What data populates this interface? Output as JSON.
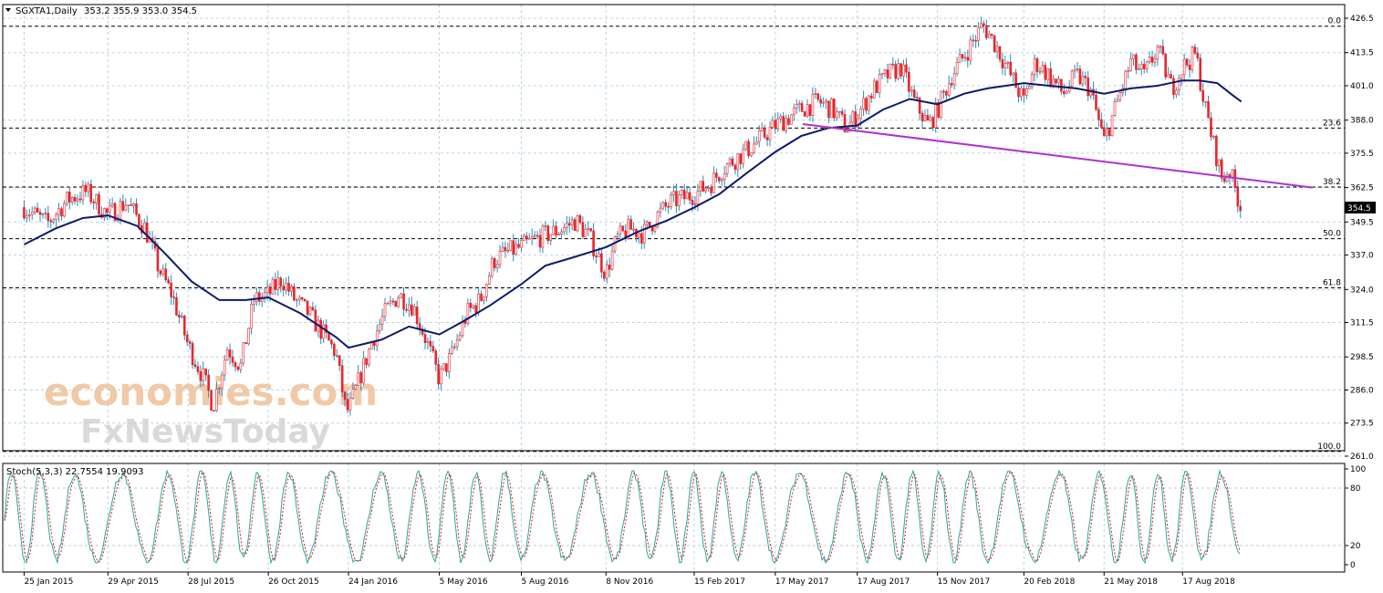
{
  "chart_data": {
    "type": "candlestick",
    "header": {
      "symbol": "SGXTA1,Daily",
      "ohlc": "353.2 355.9 353.0 354.5"
    },
    "last_price": "354.5",
    "x_ticks": [
      "25 Jan 2015",
      "29 Apr 2015",
      "28 Jul 2015",
      "26 Oct 2015",
      "24 Jan 2016",
      "5 May 2016",
      "5 Aug 2016",
      "8 Nov 2016",
      "15 Feb 2017",
      "17 May 2017",
      "17 Aug 2017",
      "15 Nov 2017",
      "20 Feb 2018",
      "21 May 2018",
      "17 Aug 2018"
    ],
    "y_ticks": [
      "426.5",
      "413.5",
      "401.0",
      "388.0",
      "375.5",
      "362.5",
      "349.5",
      "337.0",
      "324.0",
      "311.5",
      "298.5",
      "286.0",
      "273.5",
      "261.0"
    ],
    "ylim": [
      258,
      430
    ],
    "fib_levels": [
      {
        "label": "0.0",
        "price": 423.5
      },
      {
        "label": "23.6",
        "price": 385.0
      },
      {
        "label": "38.2",
        "price": 362.7
      },
      {
        "label": "50.0",
        "price": 343.2
      },
      {
        "label": "61.8",
        "price": 324.6
      },
      {
        "label": "100.0",
        "price": 262.8
      }
    ],
    "trendline": {
      "start": {
        "x": "17 Jun 2017",
        "y": 386.5
      },
      "end": {
        "x": "10 Jan 2019",
        "y": 362.5
      },
      "color": "#b030d0"
    },
    "price_close": [
      [
        "2015-01-25",
        355
      ],
      [
        "2015-02-20",
        349
      ],
      [
        "2015-03-15",
        358
      ],
      [
        "2015-04-05",
        361
      ],
      [
        "2015-04-29",
        352
      ],
      [
        "2015-05-20",
        357
      ],
      [
        "2015-06-10",
        347
      ],
      [
        "2015-06-25",
        332
      ],
      [
        "2015-07-10",
        322
      ],
      [
        "2015-07-28",
        303
      ],
      [
        "2015-08-15",
        290
      ],
      [
        "2015-08-25",
        280
      ],
      [
        "2015-09-10",
        302
      ],
      [
        "2015-09-25",
        295
      ],
      [
        "2015-10-10",
        320
      ],
      [
        "2015-10-26",
        322
      ],
      [
        "2015-11-10",
        328
      ],
      [
        "2015-11-25",
        320
      ],
      [
        "2015-12-10",
        315
      ],
      [
        "2015-12-25",
        308
      ],
      [
        "2016-01-10",
        300
      ],
      [
        "2016-01-20",
        280
      ],
      [
        "2016-01-24",
        278
      ],
      [
        "2016-02-05",
        290
      ],
      [
        "2016-02-20",
        305
      ],
      [
        "2016-03-05",
        315
      ],
      [
        "2016-03-20",
        322
      ],
      [
        "2016-04-05",
        318
      ],
      [
        "2016-04-20",
        305
      ],
      [
        "2016-05-05",
        290
      ],
      [
        "2016-05-20",
        300
      ],
      [
        "2016-06-05",
        315
      ],
      [
        "2016-06-20",
        320
      ],
      [
        "2016-07-05",
        335
      ],
      [
        "2016-07-20",
        338
      ],
      [
        "2016-08-05",
        340
      ],
      [
        "2016-08-20",
        343
      ],
      [
        "2016-09-05",
        345
      ],
      [
        "2016-09-20",
        347
      ],
      [
        "2016-10-05",
        350
      ],
      [
        "2016-10-20",
        344
      ],
      [
        "2016-11-08",
        330
      ],
      [
        "2016-11-20",
        343
      ],
      [
        "2016-12-05",
        347
      ],
      [
        "2016-12-20",
        345
      ],
      [
        "2017-01-05",
        352
      ],
      [
        "2017-01-20",
        357
      ],
      [
        "2017-02-15",
        360
      ],
      [
        "2017-03-05",
        364
      ],
      [
        "2017-03-20",
        370
      ],
      [
        "2017-04-05",
        374
      ],
      [
        "2017-04-20",
        378
      ],
      [
        "2017-05-17",
        386
      ],
      [
        "2017-06-05",
        390
      ],
      [
        "2017-06-20",
        393
      ],
      [
        "2017-07-05",
        395
      ],
      [
        "2017-07-20",
        392
      ],
      [
        "2017-08-05",
        385
      ],
      [
        "2017-08-17",
        390
      ],
      [
        "2017-09-05",
        400
      ],
      [
        "2017-09-20",
        405
      ],
      [
        "2017-10-05",
        408
      ],
      [
        "2017-10-20",
        395
      ],
      [
        "2017-11-05",
        386
      ],
      [
        "2017-11-15",
        392
      ],
      [
        "2017-12-01",
        405
      ],
      [
        "2017-12-20",
        415
      ],
      [
        "2018-01-05",
        424
      ],
      [
        "2018-01-20",
        416
      ],
      [
        "2018-02-05",
        405
      ],
      [
        "2018-02-20",
        395
      ],
      [
        "2018-03-05",
        410
      ],
      [
        "2018-03-20",
        405
      ],
      [
        "2018-04-05",
        398
      ],
      [
        "2018-04-20",
        405
      ],
      [
        "2018-05-05",
        400
      ],
      [
        "2018-05-21",
        380
      ],
      [
        "2018-06-05",
        395
      ],
      [
        "2018-06-20",
        410
      ],
      [
        "2018-07-05",
        405
      ],
      [
        "2018-07-20",
        415
      ],
      [
        "2018-08-05",
        400
      ],
      [
        "2018-08-17",
        408
      ],
      [
        "2018-09-01",
        413
      ],
      [
        "2018-09-10",
        395
      ],
      [
        "2018-09-20",
        380
      ],
      [
        "2018-10-01",
        365
      ],
      [
        "2018-10-08",
        370
      ],
      [
        "2018-10-15",
        362
      ],
      [
        "2018-10-22",
        354.5
      ]
    ],
    "ma": [
      [
        "2015-01-25",
        341
      ],
      [
        "2015-03-01",
        347
      ],
      [
        "2015-04-01",
        351
      ],
      [
        "2015-04-29",
        352
      ],
      [
        "2015-06-01",
        348
      ],
      [
        "2015-07-01",
        338
      ],
      [
        "2015-08-01",
        327
      ],
      [
        "2015-09-01",
        320
      ],
      [
        "2015-10-01",
        320
      ],
      [
        "2015-10-26",
        321
      ],
      [
        "2015-12-01",
        315
      ],
      [
        "2016-01-10",
        306
      ],
      [
        "2016-01-24",
        302
      ],
      [
        "2016-03-01",
        305
      ],
      [
        "2016-04-01",
        310
      ],
      [
        "2016-05-05",
        307
      ],
      [
        "2016-06-01",
        312
      ],
      [
        "2016-07-01",
        318
      ],
      [
        "2016-08-05",
        326
      ],
      [
        "2016-09-01",
        333
      ],
      [
        "2016-10-01",
        336
      ],
      [
        "2016-11-08",
        340
      ],
      [
        "2016-12-15",
        346
      ],
      [
        "2017-01-15",
        350
      ],
      [
        "2017-02-15",
        355
      ],
      [
        "2017-03-15",
        360
      ],
      [
        "2017-04-15",
        368
      ],
      [
        "2017-05-17",
        376
      ],
      [
        "2017-06-15",
        382
      ],
      [
        "2017-07-15",
        385
      ],
      [
        "2017-08-17",
        386
      ],
      [
        "2017-09-15",
        392
      ],
      [
        "2017-10-15",
        396
      ],
      [
        "2017-11-15",
        394
      ],
      [
        "2017-12-15",
        398
      ],
      [
        "2018-01-10",
        400
      ],
      [
        "2018-02-20",
        402
      ],
      [
        "2018-03-20",
        401
      ],
      [
        "2018-04-20",
        400
      ],
      [
        "2018-05-21",
        398
      ],
      [
        "2018-06-20",
        400
      ],
      [
        "2018-07-20",
        401
      ],
      [
        "2018-08-17",
        403
      ],
      [
        "2018-09-05",
        403
      ],
      [
        "2018-09-25",
        402
      ],
      [
        "2018-10-10",
        398
      ],
      [
        "2018-10-22",
        395
      ]
    ],
    "stoch": {
      "label": "Stoch(5,3,3) 22.7554 19.9093",
      "y_ticks": [
        "100",
        "80",
        "20",
        "0"
      ],
      "levels": [
        20,
        80
      ]
    },
    "colors": {
      "candle": "#e8262a",
      "wick": "#2e8ab8",
      "ma": "#0c1a6b",
      "trendline": "#b030d0",
      "stoch_main": "#2aa79b",
      "stoch_signal": "#d02020",
      "grid": "#b9d4e6"
    },
    "grid": true,
    "watermark": {
      "line1": "economies.com",
      "line2": "FxNewsToday"
    }
  }
}
